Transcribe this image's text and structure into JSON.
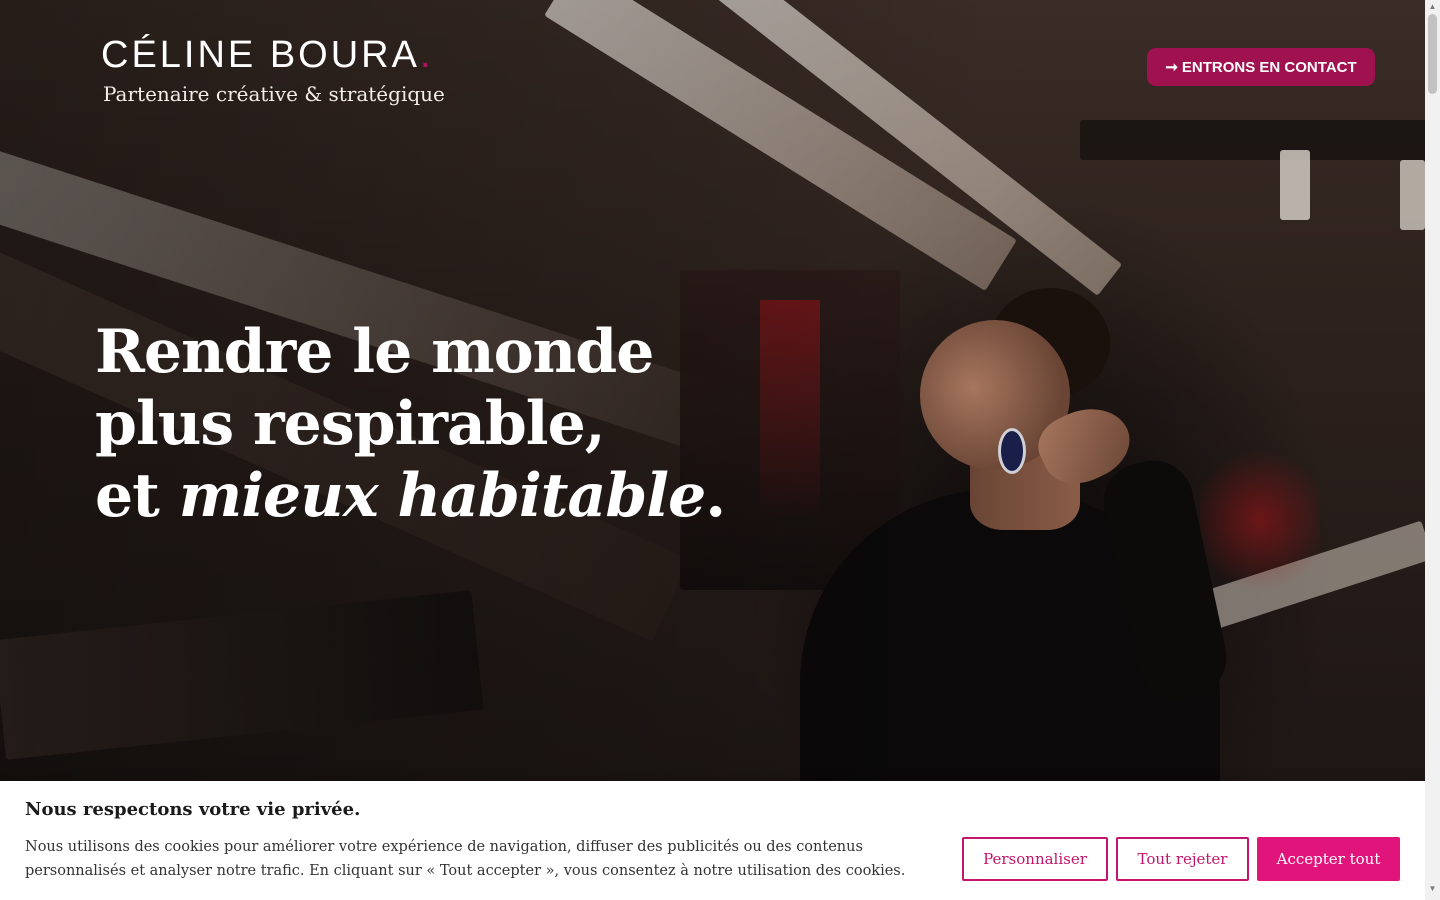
{
  "header": {
    "brand_name": "CÉLINE BOURA",
    "brand_dot": ".",
    "tagline": "Partenaire créative & stratégique",
    "cta_arrow": "➞",
    "cta_label": "ENTRONS EN CONTACT"
  },
  "hero": {
    "line1": "Rendre le monde",
    "line2": "plus respirable,",
    "line3_start": "et ",
    "line3_italic": "mieux habitable",
    "line3_end": "."
  },
  "cookie_banner": {
    "title": "Nous respectons votre vie privée.",
    "text": "Nous utilisons des cookies pour améliorer votre expérience de navigation, diffuser des publicités ou des contenus personnalisés et analyser notre trafic. En cliquant sur « Tout accepter », vous consentez à notre utilisation des cookies.",
    "customize_label": "Personnaliser",
    "reject_label": "Tout rejeter",
    "accept_label": "Accepter tout"
  },
  "colors": {
    "accent": "#a0124f",
    "cookie_accent": "#e0147a",
    "text_light": "#ffffff"
  },
  "icons": {
    "cta_icon": "arrow-right-icon",
    "scroll_up": "scroll-up-arrow-icon",
    "scroll_down": "scroll-down-arrow-icon"
  }
}
